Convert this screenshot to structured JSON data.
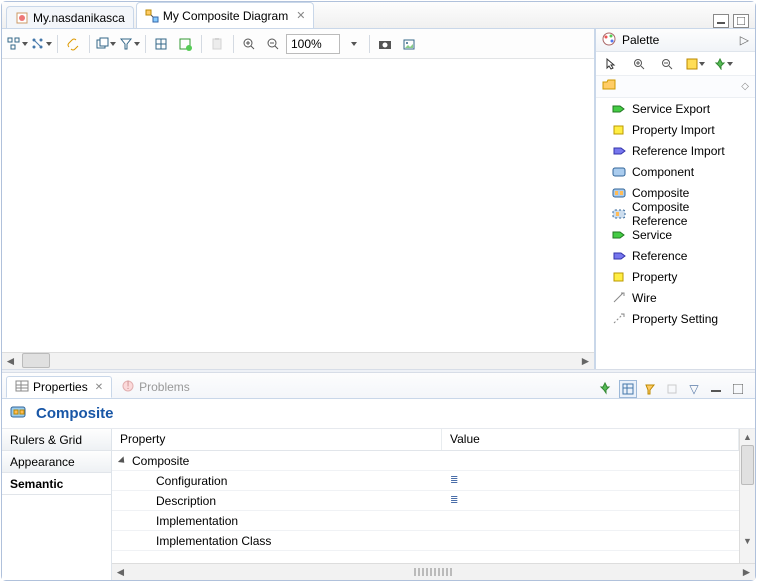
{
  "tabs": {
    "inactive_label": "My.nasdanikasca",
    "active_label": "My Composite Diagram"
  },
  "toolbar": {
    "zoom_value": "100%"
  },
  "palette": {
    "title": "Palette",
    "items": [
      "Service Export",
      "Property Import",
      "Reference Import",
      "Component",
      "Composite",
      "Composite Reference",
      "Service",
      "Reference",
      "Property",
      "Wire",
      "Property Setting"
    ]
  },
  "views": {
    "properties_label": "Properties",
    "problems_label": "Problems"
  },
  "composite": {
    "title": "Composite"
  },
  "side_tabs": {
    "rulers": "Rulers & Grid",
    "appearance": "Appearance",
    "semantic": "Semantic"
  },
  "prop_table": {
    "col_property": "Property",
    "col_value": "Value",
    "group": "Composite",
    "rows": [
      "Configuration",
      "Description",
      "Implementation",
      "Implementation Class"
    ],
    "value_glyph": "≣"
  }
}
